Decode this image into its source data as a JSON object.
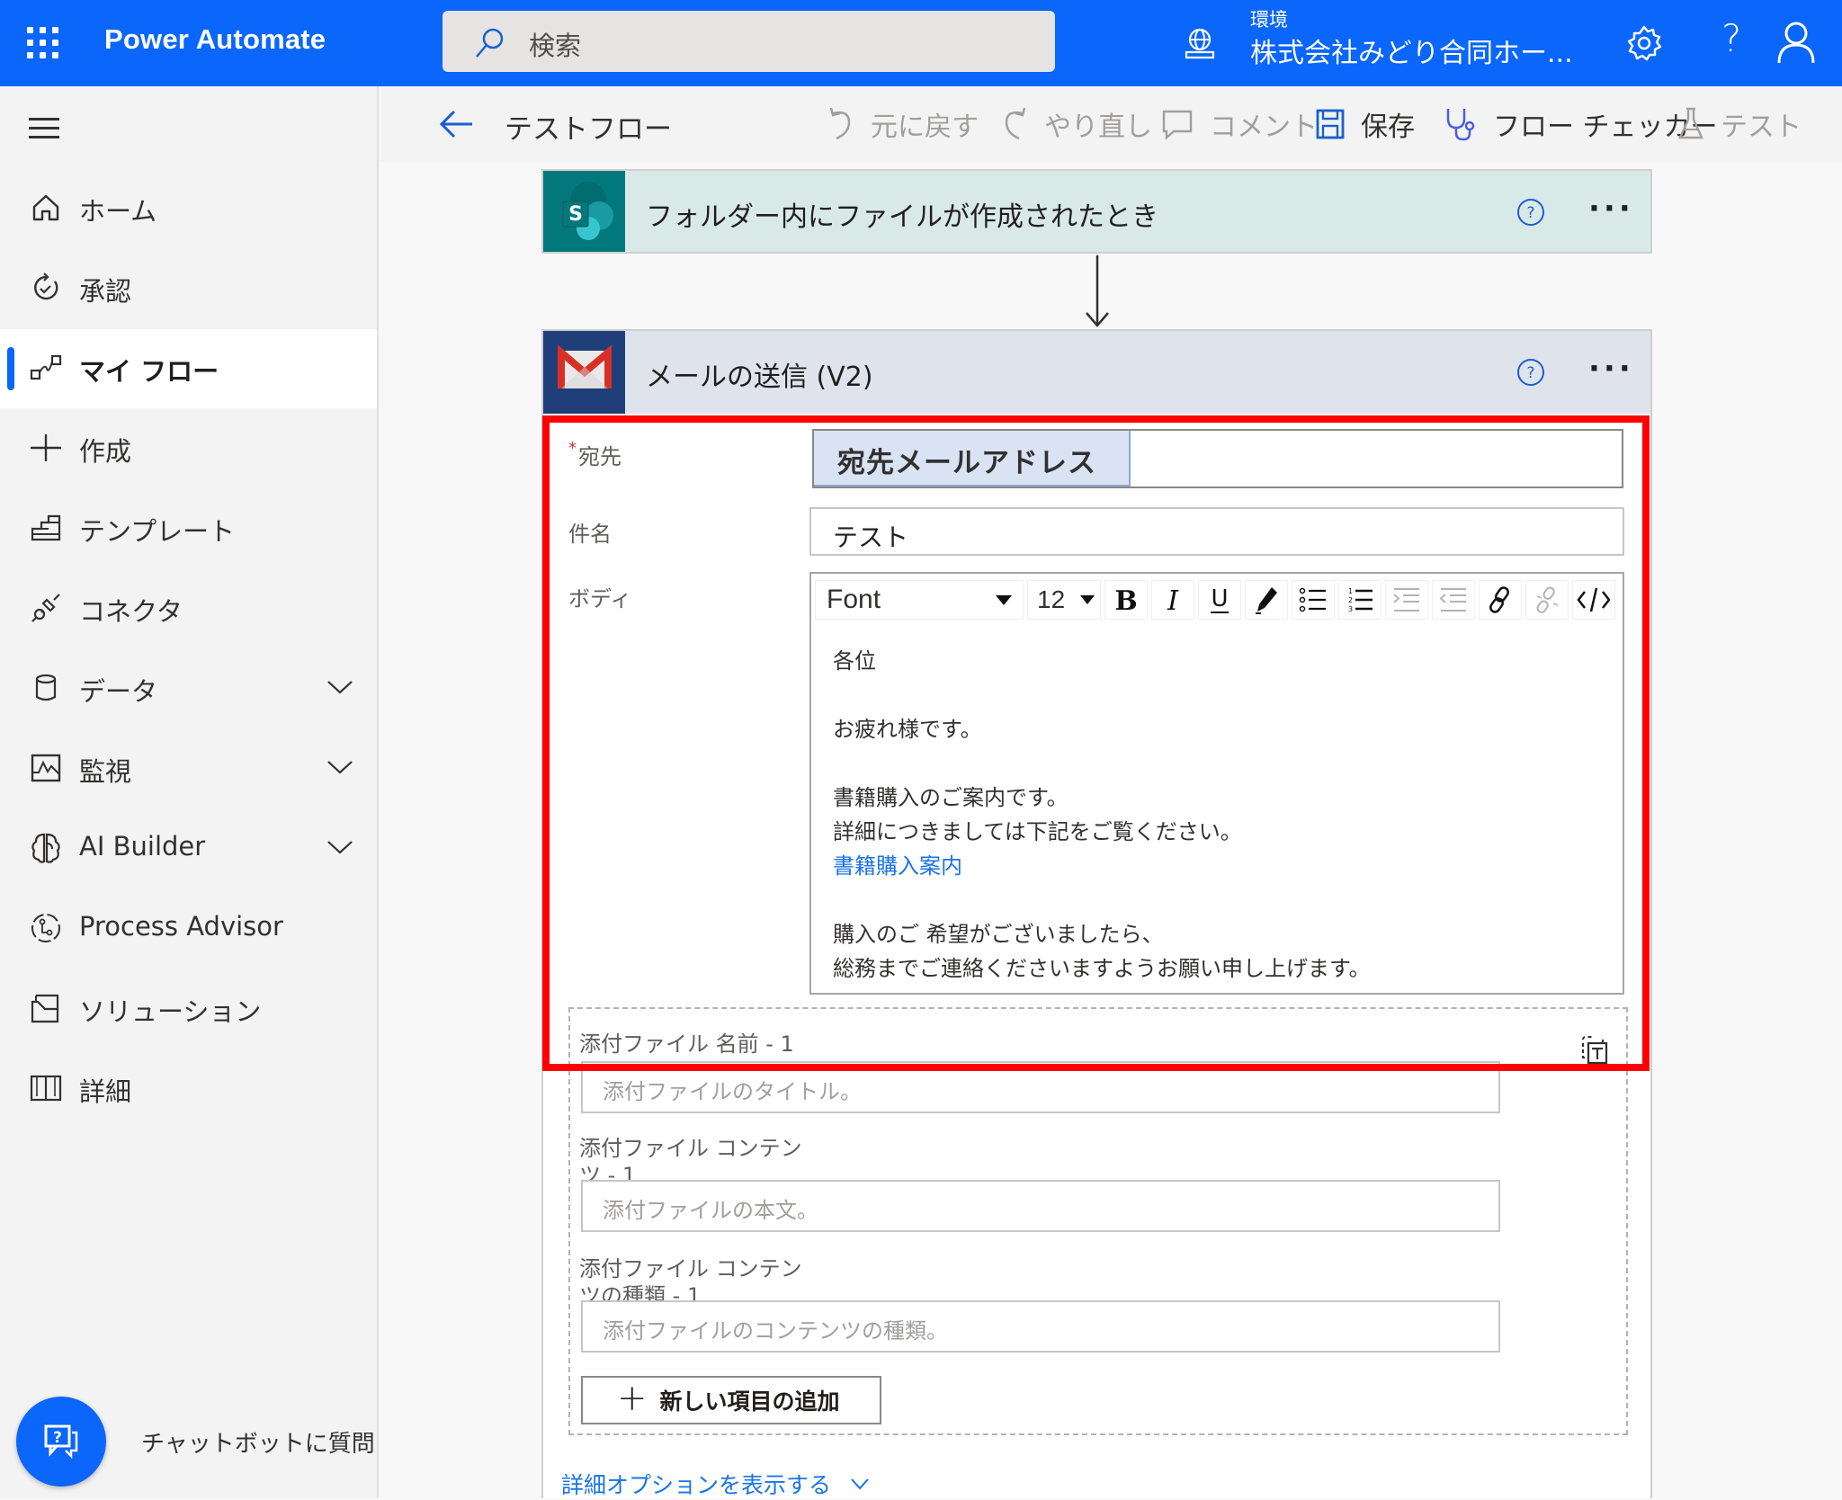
{
  "header": {
    "app_title": "Power Automate",
    "search_placeholder": "検索",
    "environment_label": "環境",
    "environment_name": "株式会社みどり合同ホー...",
    "help_glyph": "?",
    "icons": [
      "waffle-icon",
      "search-icon",
      "environment-icon",
      "settings-icon",
      "help-icon",
      "user-icon"
    ]
  },
  "sidebar": {
    "items": [
      {
        "label": "ホーム",
        "icon": "home-icon",
        "active": false,
        "expandable": false
      },
      {
        "label": "承認",
        "icon": "approvals-icon",
        "active": false,
        "expandable": false
      },
      {
        "label": "マイ フロー",
        "icon": "my-flows-icon",
        "active": true,
        "expandable": false
      },
      {
        "label": "作成",
        "icon": "create-icon",
        "active": false,
        "expandable": false
      },
      {
        "label": "テンプレート",
        "icon": "templates-icon",
        "active": false,
        "expandable": false
      },
      {
        "label": "コネクタ",
        "icon": "connectors-icon",
        "active": false,
        "expandable": false
      },
      {
        "label": "データ",
        "icon": "data-icon",
        "active": false,
        "expandable": true
      },
      {
        "label": "監視",
        "icon": "monitor-icon",
        "active": false,
        "expandable": true
      },
      {
        "label": "AI Builder",
        "icon": "ai-builder-icon",
        "active": false,
        "expandable": true
      },
      {
        "label": "Process Advisor",
        "icon": "process-advisor-icon",
        "active": false,
        "expandable": false
      },
      {
        "label": "ソリューション",
        "icon": "solutions-icon",
        "active": false,
        "expandable": false
      },
      {
        "label": "詳細",
        "icon": "learn-icon",
        "active": false,
        "expandable": false
      }
    ],
    "chatbot_label": "チャットボットに質問"
  },
  "commandbar": {
    "flow_name": "テストフロー",
    "undo": "元に戻す",
    "redo": "やり直し",
    "comment": "コメント",
    "save": "保存",
    "flow_checker": "フロー チェッカー",
    "test": "テスト"
  },
  "trigger_card": {
    "title": "フォルダー内にファイルが作成されたとき",
    "connector": "SharePoint",
    "accent_color": "#03787c"
  },
  "action_card": {
    "title": "メールの送信 (V2)",
    "connector": "Gmail",
    "accent_color": "#203f7a",
    "fields": {
      "to": {
        "label": "宛先",
        "required": true,
        "token": "宛先メールアドレス"
      },
      "subject": {
        "label": "件名",
        "value": "テスト"
      },
      "body": {
        "label": "ボディ",
        "toolbar": {
          "font": "Font",
          "size": "12",
          "buttons": [
            "bold",
            "italic",
            "underline",
            "highlight",
            "bulleted-list",
            "numbered-list",
            "indent",
            "outdent",
            "link",
            "unlink",
            "code-view"
          ]
        },
        "lines": [
          {
            "text": "各位",
            "link": false
          },
          {
            "text": "",
            "link": false
          },
          {
            "text": "お疲れ様です。",
            "link": false
          },
          {
            "text": "",
            "link": false
          },
          {
            "text": "書籍購入のご案内です。",
            "link": false
          },
          {
            "text": "詳細につきましては下記をご覧ください。",
            "link": false
          },
          {
            "text": "書籍購入案内",
            "link": true
          },
          {
            "text": "",
            "link": false
          },
          {
            "text": "購入のご 希望がございましたら、",
            "link": false
          },
          {
            "text": "総務までご連絡くださいますようお願い申し上げます。",
            "link": false
          }
        ]
      }
    },
    "attachments": {
      "name_label": "添付ファイル 名前 - 1",
      "name_placeholder": "添付ファイルのタイトル。",
      "content_label": "添付ファイル コンテンツ - 1",
      "content_placeholder": "添付ファイルの本文。",
      "type_label": "添付ファイル コンテンツの種類 - 1",
      "type_placeholder": "添付ファイルのコンテンツの種類。",
      "add_item_label": "新しい項目の追加"
    },
    "advanced_options_label": "詳細オプションを表示する"
  },
  "highlight_color": "#ff0000"
}
